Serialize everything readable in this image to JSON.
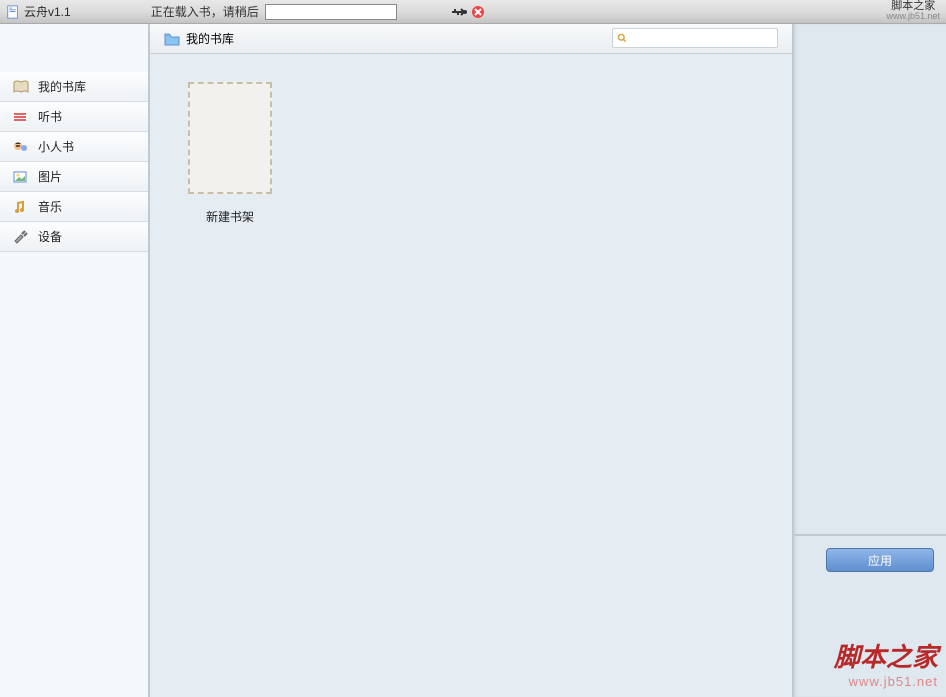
{
  "app": {
    "title": "云舟v1.1",
    "loading_text": "正在载入书，请稍后"
  },
  "watermark": {
    "name_top": "脚本之家",
    "url_top": "www.jb51.net",
    "name_bottom": "脚本之家",
    "url_bottom": "www.jb51.net"
  },
  "sidebar": {
    "items": [
      {
        "label": "我的书库",
        "icon": "book"
      },
      {
        "label": "听书",
        "icon": "audio"
      },
      {
        "label": "小人书",
        "icon": "comic"
      },
      {
        "label": "图片",
        "icon": "image"
      },
      {
        "label": "音乐",
        "icon": "music"
      },
      {
        "label": "设备",
        "icon": "device"
      }
    ]
  },
  "content": {
    "header_title": "我的书库",
    "search_placeholder": "",
    "shelf_label": "新建书架"
  },
  "right_panel": {
    "apply_label": "应用"
  }
}
